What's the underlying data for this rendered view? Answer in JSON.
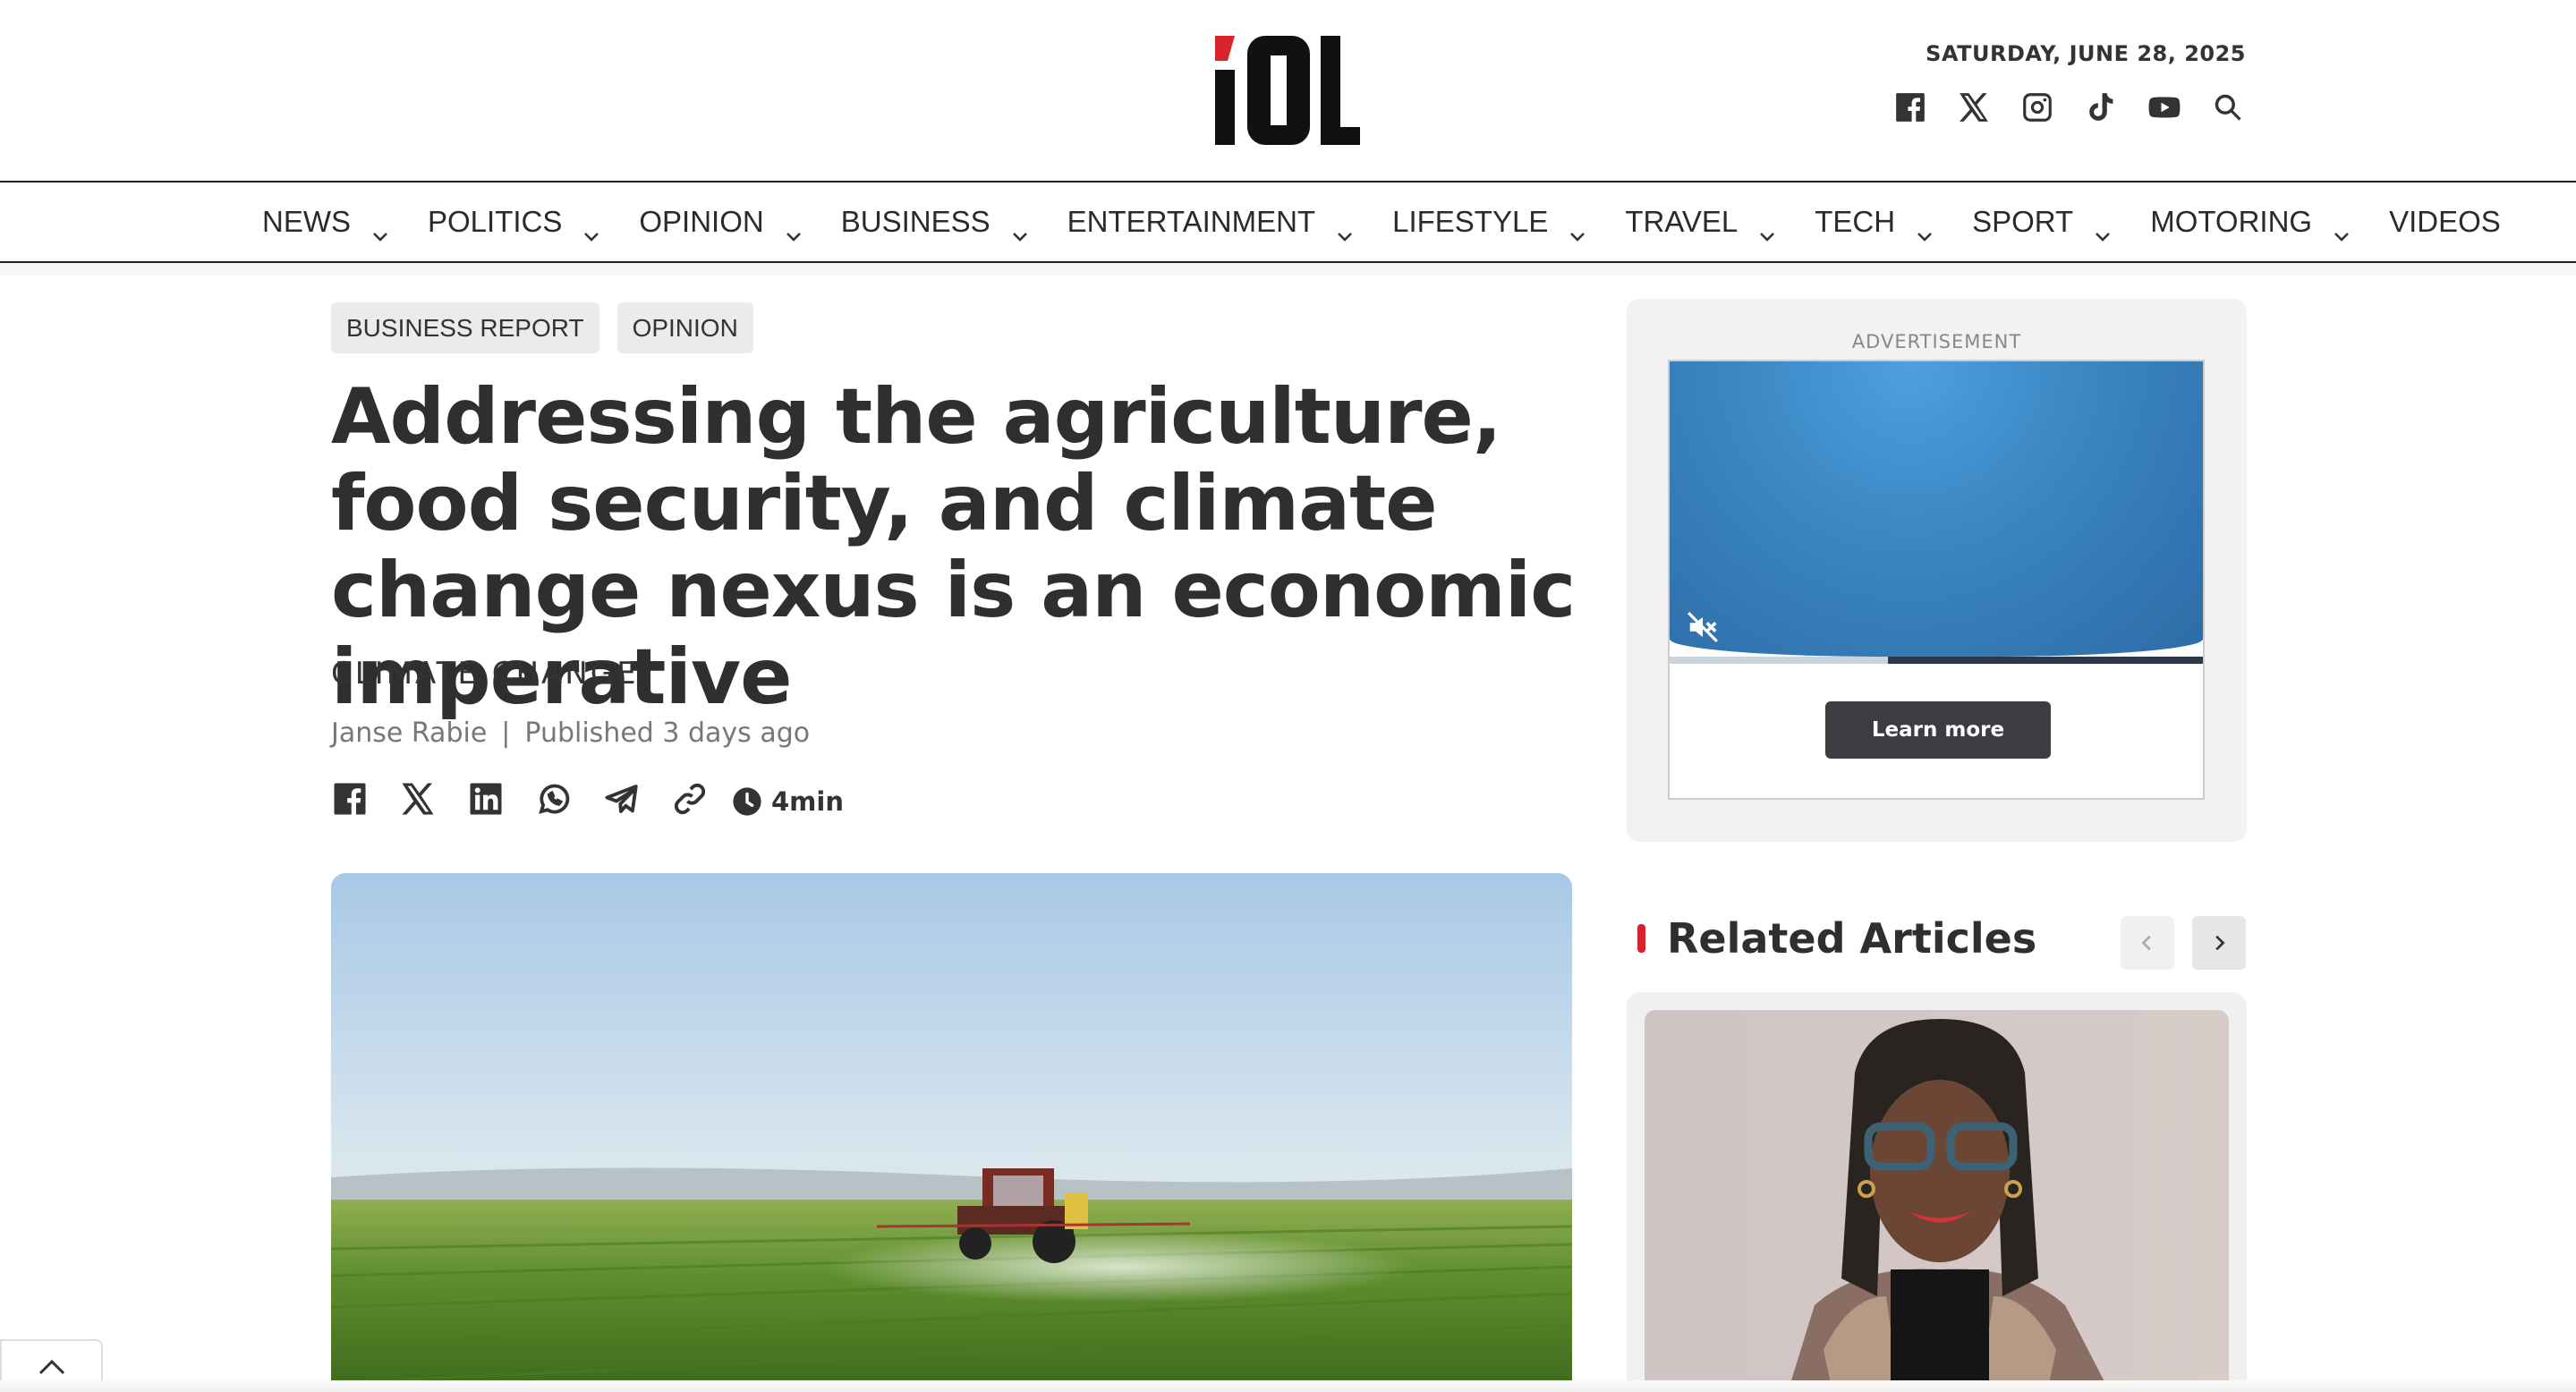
{
  "header": {
    "logo_text": "IOL",
    "date": "SATURDAY, JUNE 28, 2025",
    "social_icons": [
      "facebook-icon",
      "x-icon",
      "instagram-icon",
      "tiktok-icon",
      "youtube-icon",
      "search-icon"
    ]
  },
  "nav": {
    "items": [
      {
        "label": "NEWS",
        "has_menu": true
      },
      {
        "label": "POLITICS",
        "has_menu": true
      },
      {
        "label": "OPINION",
        "has_menu": true
      },
      {
        "label": "BUSINESS",
        "has_menu": true
      },
      {
        "label": "ENTERTAINMENT",
        "has_menu": true
      },
      {
        "label": "LIFESTYLE",
        "has_menu": true
      },
      {
        "label": "TRAVEL",
        "has_menu": true
      },
      {
        "label": "TECH",
        "has_menu": true
      },
      {
        "label": "SPORT",
        "has_menu": true
      },
      {
        "label": "MOTORING",
        "has_menu": true
      },
      {
        "label": "VIDEOS",
        "has_menu": false
      }
    ]
  },
  "article": {
    "tags": [
      "BUSINESS REPORT",
      "OPINION"
    ],
    "headline": "Addressing the agriculture, food security, and climate change nexus is an economic imperative",
    "section": "CLIMATE CHANGE",
    "author": "Janse Rabie",
    "separator": "|",
    "published": "Published 3 days ago",
    "share_icons": [
      "facebook-icon",
      "x-icon",
      "linkedin-icon",
      "whatsapp-icon",
      "telegram-icon",
      "copy-link-icon"
    ],
    "read_time": "4min"
  },
  "sidebar": {
    "ad_label": "ADVERTISEMENT",
    "ad_button": "Learn more",
    "ad_progress": 0.41,
    "related_title": "Related Articles"
  },
  "colors": {
    "accent": "#d8232a",
    "text": "#2f2f2f",
    "ad_blue": "#3a85c2"
  }
}
